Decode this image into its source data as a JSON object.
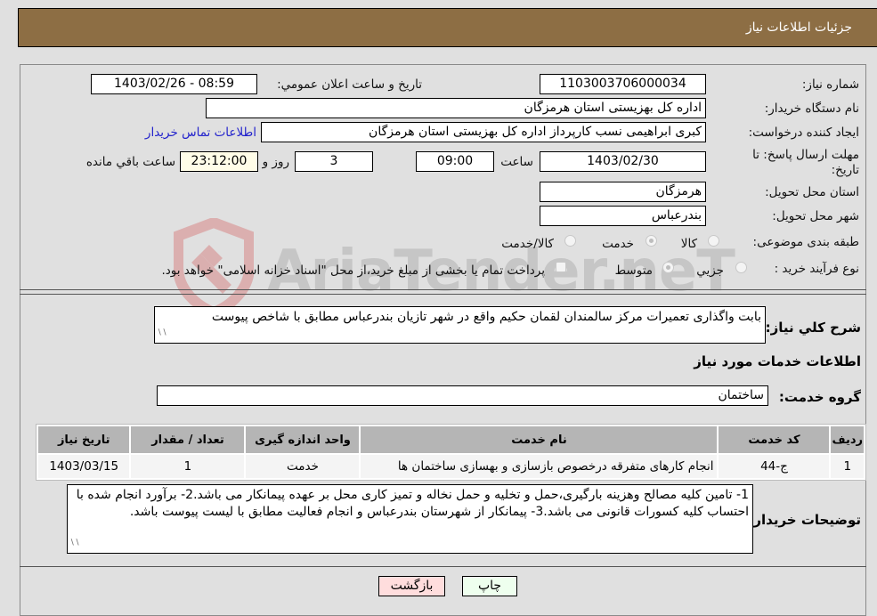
{
  "header": {
    "title": "جزئيات اطلاعات نياز"
  },
  "fields": {
    "need_number": {
      "label": "شماره نياز:",
      "value": "1103003706000034"
    },
    "announce": {
      "label": "تاريخ و ساعت اعلان عمومي:",
      "value": "1403/02/26 - 08:59"
    },
    "buyer_org": {
      "label": "نام دستگاه خريدار:",
      "value": "اداره کل بهزیستی استان هرمزگان"
    },
    "requester": {
      "label": "ايجاد کننده درخواست:",
      "value": "کبری  ابراهیمی نسب کارپرداز اداره کل بهزیستی استان هرمزگان"
    },
    "contact_link": "اطلاعات تماس خريدار",
    "deadline": {
      "label_line1": "مهلت ارسال پاسخ: تا",
      "label_line2": "تاريخ:",
      "date": "1403/02/30",
      "time_label": "ساعت",
      "time": "09:00",
      "days": "3",
      "days_label": "روز و",
      "remaining": "23:12:00",
      "remaining_label": "ساعت باقي مانده"
    },
    "province": {
      "label": "استان محل تحويل:",
      "value": "هرمزگان"
    },
    "city": {
      "label": "شهر محل تحويل:",
      "value": "بندرعباس"
    },
    "category": {
      "label": "طبقه بندی موضوعی:",
      "options": [
        "کالا",
        "خدمت",
        "کالا/خدمت"
      ],
      "selected": "خدمت"
    },
    "process": {
      "label": "نوع فرآيند خريد :",
      "options": [
        "جزيي",
        "متوسط"
      ],
      "selected": "متوسط",
      "payment_note": "پرداخت تمام يا بخشی از مبلغ خريد،از محل \"اسناد خزانه اسلامی\" خواهد بود."
    }
  },
  "description": {
    "label": "شرح کلي نياز:",
    "value": "بابت واگذاری تعمیرات مرکز سالمندان لقمان حکیم واقع در شهر تازیان بندرعباس مطابق با شاخص پیوست"
  },
  "services_section": {
    "title": "اطلاعات خدمات مورد نياز",
    "group_label": "گروه خدمت:",
    "group_value": "ساختمان",
    "table": {
      "headers": [
        "رديف",
        "کد خدمت",
        "نام خدمت",
        "واحد اندازه گيری",
        "تعداد / مقدار",
        "تاريخ نياز"
      ],
      "rows": [
        [
          "1",
          "ج-44",
          "انجام کارهای متفرقه درخصوص بازسازی و بهسازی ساختمان ها",
          "خدمت",
          "1",
          "1403/03/15"
        ]
      ]
    }
  },
  "buyer_notes": {
    "label": "توضيحات خريدار:",
    "value": "1- تامین کلیه مصالح وهزینه بارگیری،حمل و تخلیه و حمل نخاله و تمیز کاری محل بر عهده پیمانکار می باشد.2- برآورد انجام شده با احتساب کلیه کسورات قانونی می باشد.3- پیمانکار از شهرستان بندرعباس و انجام فعالیت مطابق با لیست پیوست باشد."
  },
  "buttons": {
    "print": "چاپ",
    "back": "بازگشت"
  },
  "colors": {
    "header_bg": "#8d6e44",
    "print_bg": "#eeffee",
    "back_bg": "#ffdddd",
    "link": "#2222cc"
  },
  "watermark": {
    "text": "AriaTender.neT"
  }
}
